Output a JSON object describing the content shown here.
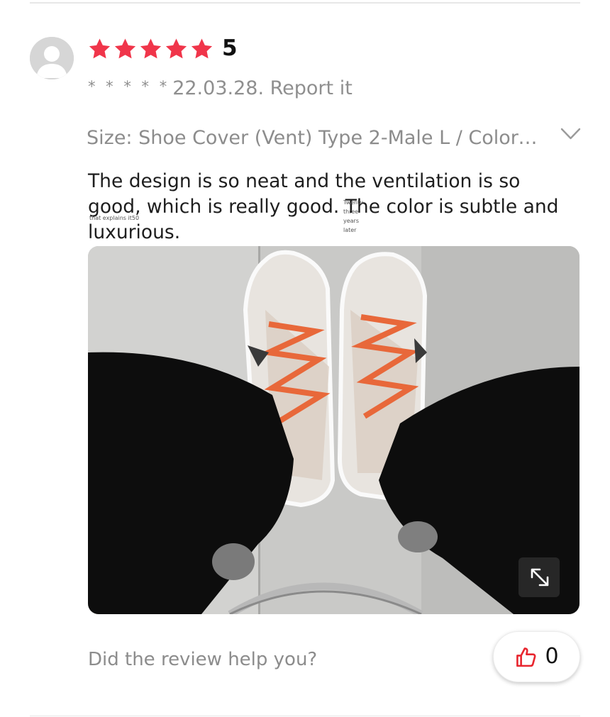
{
  "review": {
    "rating": "5",
    "stars": 5,
    "reviewer_masked": "* * * * *",
    "date_report": "22.03.28. Report it",
    "variant": "Size: Shoe Cover (Vent) Type 2-Male L / Color:...",
    "text": "The design is so neat and the ventilation is so good, which is really good. The color is subtle and luxurious.",
    "overlay_left": "that explains it50",
    "overlay_mid": "Twenty three years later"
  },
  "footer": {
    "helpful_question": "Did the review help you?",
    "like_count": "0"
  },
  "colors": {
    "star": "#f0354a",
    "like_icon": "#e8262f",
    "muted_text": "#8c8c8c"
  },
  "icons": {
    "avatar": "user-avatar-placeholder",
    "star": "star-icon",
    "chevron": "chevron-down-icon",
    "expand": "expand-diagonal-icon",
    "like": "thumbs-up-icon"
  }
}
